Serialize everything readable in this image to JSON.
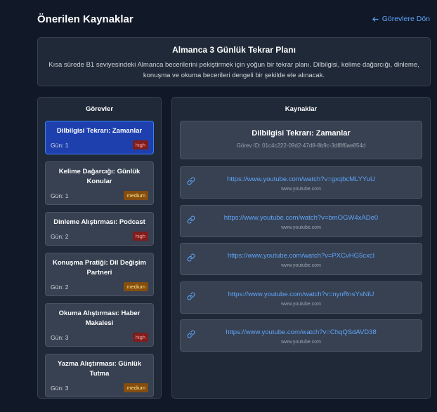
{
  "header": {
    "title": "Önerilen Kaynaklar",
    "back_label": "Görevlere Dön"
  },
  "plan": {
    "title": "Almanca 3 Günlük Tekrar Planı",
    "description": "Kısa sürede B1 seviyesindeki Almanca becerilerini pekiştirmek için yoğun bir tekrar planı. Dilbilgisi, kelime dağarcığı, dinleme, konuşma ve okuma becerileri dengeli bir şekilde ele alınacak."
  },
  "tasks_panel": {
    "title": "Görevler",
    "items": [
      {
        "title": "Dilbilgisi Tekrarı: Zamanlar",
        "day": "Gün: 1",
        "priority": "high"
      },
      {
        "title": "Kelime Dağarcığı: Günlük Konular",
        "day": "Gün: 1",
        "priority": "medium"
      },
      {
        "title": "Dinleme Alıştırması: Podcast",
        "day": "Gün: 2",
        "priority": "high"
      },
      {
        "title": "Konuşma Pratiği: Dil Değişim Partneri",
        "day": "Gün: 2",
        "priority": "medium"
      },
      {
        "title": "Okuma Alıştırması: Haber Makalesi",
        "day": "Gün: 3",
        "priority": "high"
      },
      {
        "title": "Yazma Alıştırması: Günlük Tutma",
        "day": "Gün: 3",
        "priority": "medium"
      }
    ]
  },
  "resources_panel": {
    "title": "Kaynaklar",
    "selected_title": "Dilbilgisi Tekrarı: Zamanlar",
    "selected_id": "Görev ID: 01c4c222-09d2-47d8-8b9c-3df8f6ae854d",
    "items": [
      {
        "url": "https://www.youtube.com/watch?v=gxqbcMLYYuU",
        "domain": "www.youtube.com"
      },
      {
        "url": "https://www.youtube.com/watch?v=bmOGW4xADe0",
        "domain": "www.youtube.com"
      },
      {
        "url": "https://www.youtube.com/watch?v=PXCvHG5cxcI",
        "domain": "www.youtube.com"
      },
      {
        "url": "https://www.youtube.com/watch?v=nynRnsYsNiU",
        "domain": "www.youtube.com"
      },
      {
        "url": "https://www.youtube.com/watch?v=ChqQSdAVD38",
        "domain": "www.youtube.com"
      }
    ]
  },
  "colors": {
    "background": "#111827",
    "panel": "#1f2937",
    "card": "#374151",
    "active_task": "#1e40af",
    "link": "#60a5fa",
    "high_badge": "#7f1d1d",
    "medium_badge": "#854d0e"
  },
  "icons": {
    "back": "arrow-left-icon",
    "resource": "link-icon"
  }
}
